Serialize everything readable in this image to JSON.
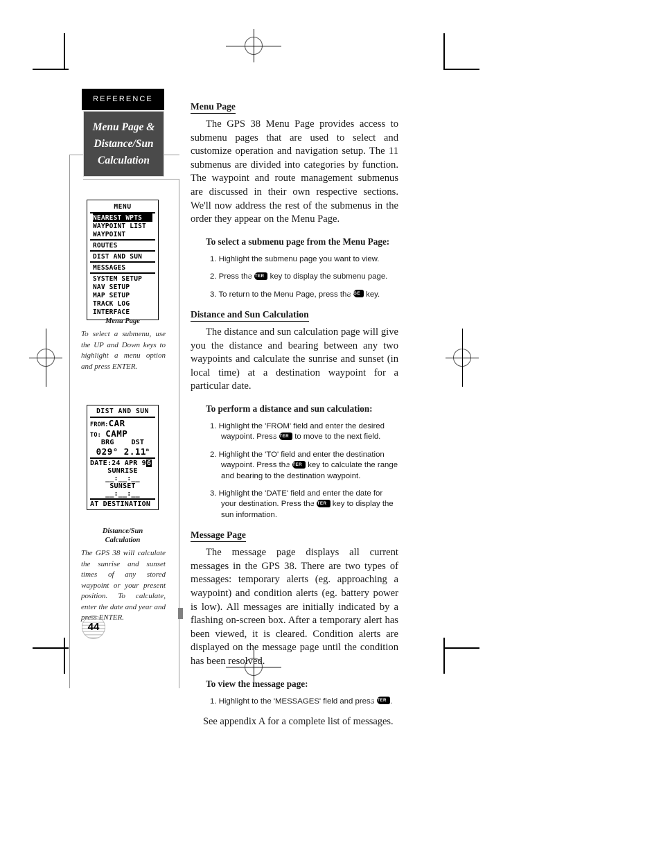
{
  "sidebar": {
    "reference_tab": "REFERENCE",
    "chapter_title_line1": "Menu Page &",
    "chapter_title_line2": "Distance/Sun",
    "chapter_title_line3": "Calculation",
    "page_number": "44"
  },
  "menu_screen": {
    "title": "MENU",
    "group1": [
      "NEAREST WPTS",
      "WAYPOINT LIST",
      "WAYPOINT"
    ],
    "group1_selected": "NEAREST WPTS",
    "group2": [
      "ROUTES"
    ],
    "group3": [
      "DIST AND SUN"
    ],
    "group4": [
      "MESSAGES"
    ],
    "group5": [
      "SYSTEM SETUP",
      "NAV SETUP",
      "MAP SETUP",
      "TRACK LOG",
      "INTERFACE"
    ]
  },
  "menu_caption": {
    "title": "Menu Page",
    "body": "To select a submenu, use the UP and Down keys to highlight a menu option and press ENTER."
  },
  "dist_screen": {
    "title": "DIST AND SUN",
    "from_label": "FROM:",
    "from_value": "CAR",
    "to_label": "TO:",
    "to_value": "CAMP",
    "brg_label": "BRG",
    "dst_label": "DST",
    "brg_value": "029°",
    "dst_value": "2.11",
    "dst_unit": "m",
    "date_label": "DATE:",
    "date_value": "24 APR 9",
    "date_cursor": "6",
    "sunrise_label": "SUNRISE",
    "sunrise_value": "__:__:__",
    "sunset_label": "SUNSET",
    "sunset_value": "__:__:__",
    "footer": "AT DESTINATION"
  },
  "dist_caption": {
    "title_line1": "Distance/Sun",
    "title_line2": "Calculation",
    "body": "The GPS 38 will calculate the sunrise and sunset times of any stored waypoint or your present position. To calculate, enter the date and year and press ENTER."
  },
  "main": {
    "section1": {
      "heading": "Menu Page",
      "paragraph": "The GPS 38 Menu Page provides access to submenu pages that are used to select and customize operation and navigation setup. The 11 submenus are divided into categories by function. The waypoint and route management submenus are discussed in their own respective sections. We'll now address the rest of the submenus in the order they appear on the Menu Page.",
      "steps_heading": "To select a submenu page from the Menu Page:",
      "steps": [
        {
          "num": "1.",
          "pre": "Highlight the submenu page you want to view.",
          "key": "",
          "post": ""
        },
        {
          "num": "2.",
          "pre": "Press the",
          "key": "ENTER",
          "post": "key to display the submenu page."
        },
        {
          "num": "3.",
          "pre": "To return to the Menu Page, press the",
          "key": "PAGE",
          "post": "key."
        }
      ]
    },
    "section2": {
      "heading": "Distance and Sun Calculation",
      "paragraph": "The distance and sun calculation page will give you the distance and bearing between any two waypoints and calculate the sunrise and sunset (in local time) at a destination waypoint for a particular date.",
      "steps_heading": "To perform a distance and sun calculation:",
      "steps": [
        {
          "num": "1.",
          "pre": "Highlight the 'FROM' field and enter the desired waypoint. Press",
          "key": "ENTER",
          "post": "to move to the next field."
        },
        {
          "num": "2.",
          "pre": "Highlight the 'TO' field and enter the destination waypoint. Press the",
          "key": "ENTER",
          "post": "key to calculate the range and bearing to the destination waypoint."
        },
        {
          "num": "3.",
          "pre": "Highlight the 'DATE' field and enter the date for your destination. Press the",
          "key": "ENTER",
          "post": "key to display the sun information."
        }
      ]
    },
    "section3": {
      "heading": "Message Page",
      "paragraph": "The message page displays all current messages in the GPS 38. There are two types of messages: temporary alerts (eg. approaching a waypoint) and condition alerts (eg. battery power is low). All messages are initially indicated by a flashing on-screen box. After a temporary alert has been viewed, it is cleared. Condition alerts are displayed on the message page until the condition has been resolved.",
      "steps_heading": "To view the message page:",
      "steps": [
        {
          "num": "1.",
          "pre": "Highlight to the 'MESSAGES' field and press",
          "key": "ENTER",
          "post": "."
        }
      ],
      "note": "See appendix A for a complete list of messages."
    }
  }
}
